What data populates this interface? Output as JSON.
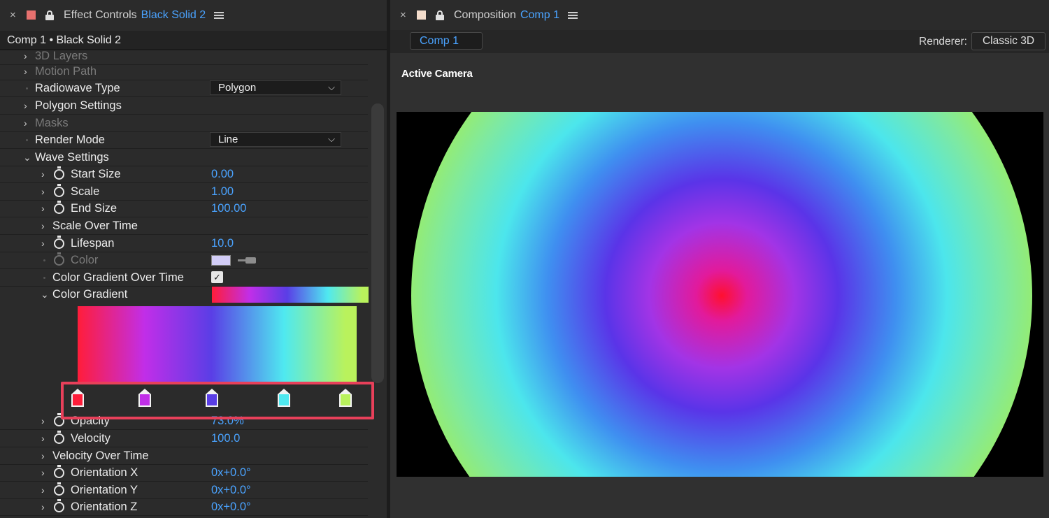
{
  "effect_controls": {
    "tab_close": "×",
    "tab_title": "Effect Controls",
    "tab_subject": "Black Solid 2",
    "tab_swatch_color": "#e7716f",
    "layer_title": "Comp 1 • Black Solid 2",
    "rows": {
      "layers3d": "3D Layers",
      "motion_path": "Motion Path",
      "radiowave_type": "Radiowave Type",
      "radiowave_type_value": "Polygon",
      "polygon_settings": "Polygon Settings",
      "masks": "Masks",
      "render_mode": "Render Mode",
      "render_mode_value": "Line",
      "wave_settings": "Wave Settings",
      "start_size": "Start Size",
      "start_size_value": "0.00",
      "scale": "Scale",
      "scale_value": "1.00",
      "end_size": "End Size",
      "end_size_value": "100.00",
      "scale_over_time": "Scale Over Time",
      "lifespan": "Lifespan",
      "lifespan_value": "10.0",
      "color": "Color",
      "color_value": "#d2cdf7",
      "color_gradient_over_time": "Color Gradient Over Time",
      "color_gradient_over_time_checked": true,
      "color_gradient": "Color Gradient",
      "opacity": "Opacity",
      "opacity_value": "73.0%",
      "velocity": "Velocity",
      "velocity_value": "100.0",
      "velocity_over_time": "Velocity Over Time",
      "orientation_x": "Orientation X",
      "orientation_x_value": "0x+0.0°",
      "orientation_y": "Orientation Y",
      "orientation_y_value": "0x+0.0°",
      "orientation_z": "Orientation Z",
      "orientation_z_value": "0x+0.0°"
    },
    "gradient_stops": [
      {
        "color": "#ff1d3a",
        "position": 0.0
      },
      {
        "color": "#c12ee8",
        "position": 0.24
      },
      {
        "color": "#5a3ee6",
        "position": 0.48
      },
      {
        "color": "#4fe9f0",
        "position": 0.74
      },
      {
        "color": "#b9f25c",
        "position": 0.96
      }
    ]
  },
  "composition": {
    "tab_close": "×",
    "tab_title": "Composition",
    "tab_subject": "Comp 1",
    "tab_swatch_color": "#f3dccb",
    "comp_name": "Comp 1",
    "renderer_label": "Renderer:",
    "renderer_value": "Classic 3D",
    "camera_label": "Active Camera"
  },
  "colors": {
    "accent": "#4aa3ff",
    "highlight": "#e8405a"
  }
}
